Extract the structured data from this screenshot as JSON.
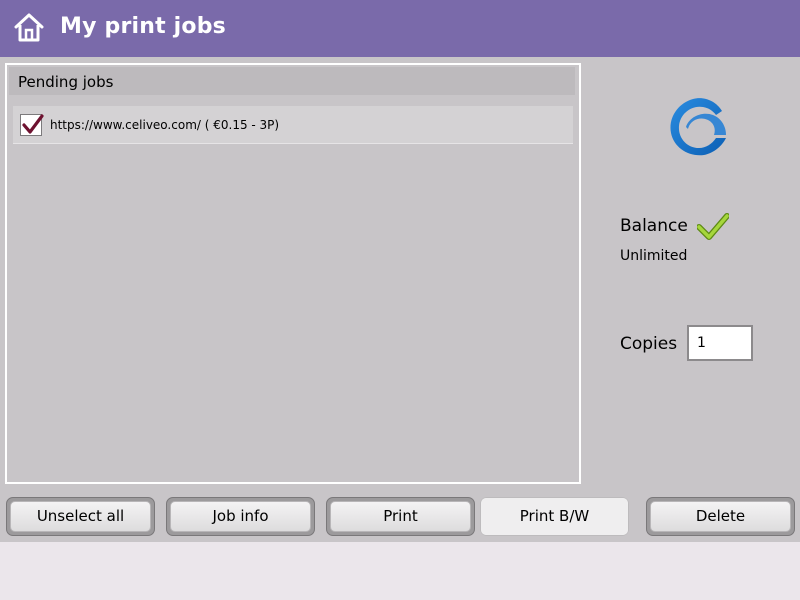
{
  "header": {
    "title": "My print jobs",
    "home_icon": "home-icon",
    "background_color": "#7a6aaa"
  },
  "jobs_panel": {
    "title": "Pending jobs",
    "jobs": [
      {
        "label": "https://www.celiveo.com/ ( €0.15 - 3P)",
        "checked": true
      }
    ]
  },
  "sidebar": {
    "logo_icon": "celiveo-logo-icon",
    "balance_label": "Balance",
    "balance_status_icon": "green-check-icon",
    "balance_value": "Unlimited",
    "copies_label": "Copies",
    "copies_value": "1"
  },
  "buttons": {
    "unselect_all": "Unselect all",
    "job_info": "Job info",
    "print": "Print",
    "print_bw": "Print B/W",
    "delete": "Delete"
  }
}
